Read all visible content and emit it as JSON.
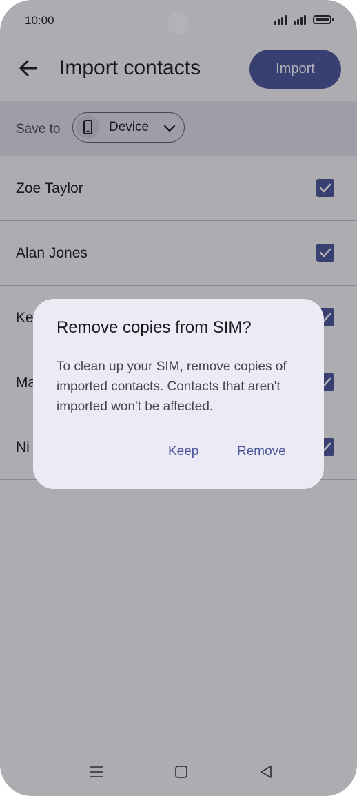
{
  "status_bar": {
    "time": "10:00"
  },
  "app_bar": {
    "title": "Import contacts",
    "import_label": "Import"
  },
  "save_to": {
    "label": "Save to",
    "selected": "Device"
  },
  "contacts": [
    {
      "name": "Zoe Taylor",
      "checked": true
    },
    {
      "name": "Alan Jones",
      "checked": true
    },
    {
      "name": "Ke",
      "checked": true
    },
    {
      "name": "Ma",
      "checked": true
    },
    {
      "name": "Ni",
      "checked": true
    }
  ],
  "dialog": {
    "title": "Remove copies from SIM?",
    "body": "To clean up your SIM, remove copies of imported contacts. Contacts that aren't imported won't be affected.",
    "keep_label": "Keep",
    "remove_label": "Remove"
  },
  "icons": {
    "back": "arrow-back-icon",
    "chip": "phone-device-icon",
    "chevron": "chevron-down-icon",
    "nav_recent": "menu-lines-icon",
    "nav_home": "square-home-icon",
    "nav_back": "triangle-back-icon"
  },
  "colors": {
    "accent": "#4a5699",
    "dialog_bg": "#ecebf5",
    "save_to_bg": "#dfe0e8"
  }
}
